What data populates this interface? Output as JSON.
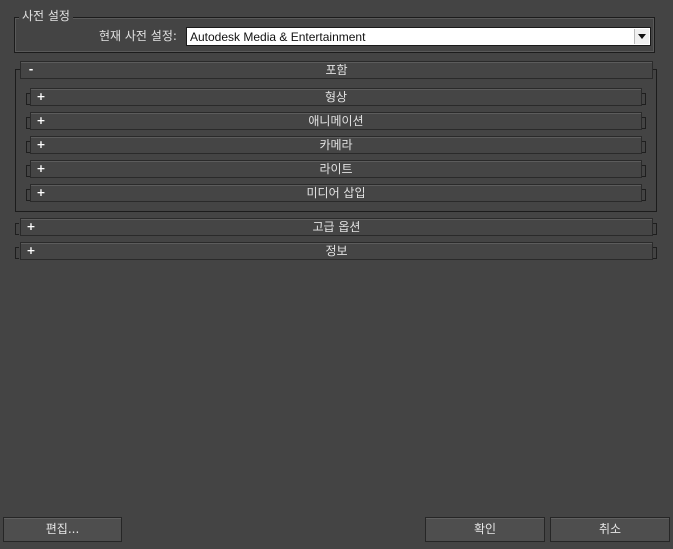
{
  "preset": {
    "group_title": "사전 설정",
    "label": "현재 사전 설정:",
    "selected_value": "Autodesk Media & Entertainment"
  },
  "rollouts": {
    "include": {
      "toggle": "-",
      "label": "포함"
    },
    "children": [
      {
        "toggle": "+",
        "label": "형상"
      },
      {
        "toggle": "+",
        "label": "애니메이션"
      },
      {
        "toggle": "+",
        "label": "카메라"
      },
      {
        "toggle": "+",
        "label": "라이트"
      },
      {
        "toggle": "+",
        "label": "미디어 삽입"
      }
    ],
    "advanced": {
      "toggle": "+",
      "label": "고급 옵션"
    },
    "info": {
      "toggle": "+",
      "label": "정보"
    }
  },
  "buttons": {
    "edit": "편집...",
    "ok": "확인",
    "cancel": "취소"
  }
}
